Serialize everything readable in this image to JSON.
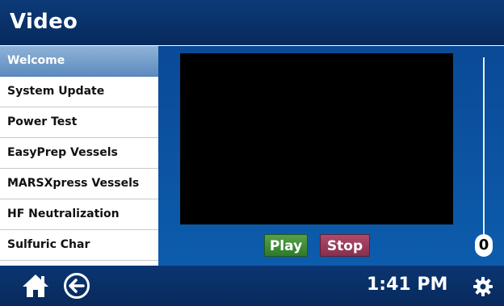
{
  "app": {
    "title": "Video"
  },
  "sidebar": {
    "items": [
      {
        "label": "Welcome",
        "selected": true
      },
      {
        "label": "System Update",
        "selected": false
      },
      {
        "label": "Power Test",
        "selected": false
      },
      {
        "label": "EasyPrep Vessels",
        "selected": false
      },
      {
        "label": "MARSXpress Vessels",
        "selected": false
      },
      {
        "label": "HF Neutralization",
        "selected": false
      },
      {
        "label": "Sulfuric Char",
        "selected": false
      }
    ]
  },
  "player": {
    "play_label": "Play",
    "stop_label": "Stop",
    "volume_value": "0"
  },
  "footer": {
    "time": "1:41 PM",
    "icons": [
      "home-icon",
      "back-arrow-icon",
      "gear-icon"
    ]
  },
  "colors": {
    "title_bar": "#0c3a78",
    "content_bg": "#0a4a96",
    "selected_item": "#6f97c6",
    "play_button": "#3f8a36",
    "stop_button": "#9a3a5c"
  }
}
